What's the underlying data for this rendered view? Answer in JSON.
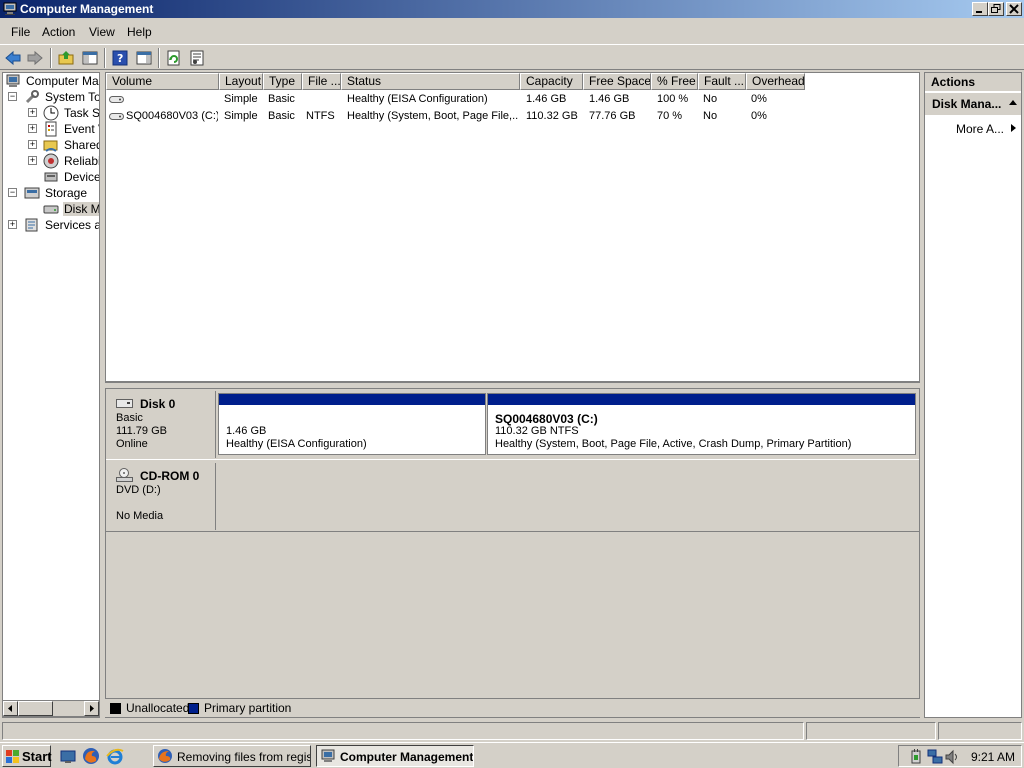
{
  "window": {
    "title": "Computer Management"
  },
  "menu": [
    "File",
    "Action",
    "View",
    "Help"
  ],
  "tree": {
    "items": [
      {
        "label": "Computer Mana",
        "icon": "computer-icon"
      },
      {
        "label": "System Too",
        "icon": "tools-icon"
      },
      {
        "label": "Task S",
        "icon": "clock-icon"
      },
      {
        "label": "Event V",
        "icon": "event-viewer-icon"
      },
      {
        "label": "Shared",
        "icon": "shared-folders-icon"
      },
      {
        "label": "Reliabi",
        "icon": "reliability-icon"
      },
      {
        "label": "Device",
        "icon": "device-manager-icon"
      },
      {
        "label": "Storage",
        "icon": "storage-icon"
      },
      {
        "label": "Disk M",
        "icon": "disk-management-icon"
      },
      {
        "label": "Services an",
        "icon": "services-icon"
      }
    ]
  },
  "volume_list": {
    "columns": [
      "Volume",
      "Layout",
      "Type",
      "File ...",
      "Status",
      "Capacity",
      "Free Space",
      "% Free",
      "Fault ...",
      "Overhead"
    ],
    "rows": [
      {
        "volume": "",
        "layout": "Simple",
        "type": "Basic",
        "fs": "",
        "status": "Healthy (EISA Configuration)",
        "capacity": "1.46 GB",
        "free": "1.46 GB",
        "pct_free": "100 %",
        "fault": "No",
        "overhead": "0%"
      },
      {
        "volume": "SQ004680V03 (C:)",
        "layout": "Simple",
        "type": "Basic",
        "fs": "NTFS",
        "status": "Healthy (System, Boot, Page File,...",
        "capacity": "110.32 GB",
        "free": "77.76 GB",
        "pct_free": "70 %",
        "fault": "No",
        "overhead": "0%"
      }
    ]
  },
  "disks": [
    {
      "name": "Disk 0",
      "type": "Basic",
      "size": "111.79 GB",
      "state": "Online",
      "partitions": [
        {
          "title": "",
          "size": "1.46 GB",
          "status": "Healthy (EISA Configuration)"
        },
        {
          "title": "SQ004680V03  (C:)",
          "size": "110.32 GB NTFS",
          "status": "Healthy (System, Boot, Page File, Active, Crash Dump, Primary Partition)"
        }
      ]
    },
    {
      "name": "CD-ROM 0",
      "type": "DVD (D:)",
      "media": "No Media"
    }
  ],
  "legend": [
    {
      "label": "Unallocated",
      "color": "#000000"
    },
    {
      "label": "Primary partition",
      "color": "#001f8c"
    }
  ],
  "actions": {
    "title": "Actions",
    "group": "Disk Mana...",
    "more": "More A..."
  },
  "taskbar": {
    "start": "Start",
    "tasks": [
      {
        "label": "Removing files from registr...",
        "active": false
      },
      {
        "label": "Computer Management",
        "active": true
      }
    ],
    "clock": "9:21 AM"
  },
  "colors": {
    "titlebar": "#0a246a",
    "partition_bar": "#001f8c",
    "chrome": "#d4d0c8"
  }
}
